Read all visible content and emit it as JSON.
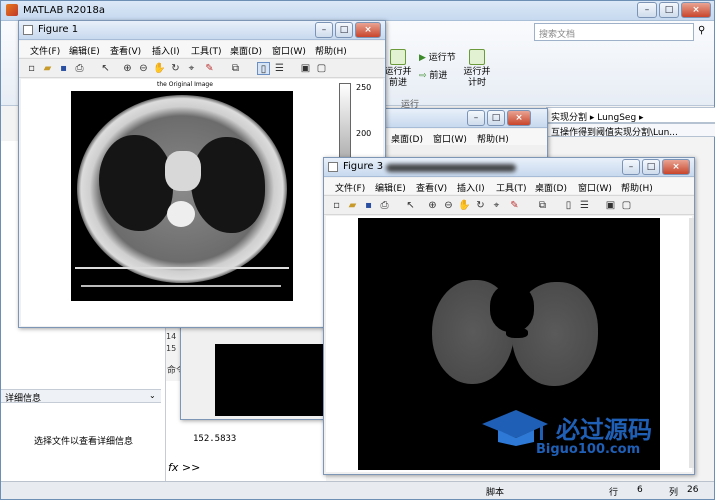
{
  "app": {
    "title": "MATLAB R2018a",
    "search_placeholder": "搜索文档"
  },
  "ribbon": {
    "run_advance_label": "运行并\n前进",
    "run_section_label": "运行节",
    "advance_label": "前进",
    "run_time_label": "运行并\n计时",
    "run_group_label": "运行"
  },
  "path": {
    "address": "实现分割 ▸ LungSeg ▸",
    "tab_text": "互操作得到阈值实现分割\\Lun..."
  },
  "left_panel": {
    "details_header": "详细信息",
    "details_text": "选择文件以查看详细信息"
  },
  "command_window": {
    "label": "命令",
    "value": "152.5833",
    "prompt": "fx >>",
    "line_numbers": [
      "14",
      "15"
    ]
  },
  "statusbar": {
    "script_label": "脚本",
    "row_label": "行",
    "row_value": "6",
    "col_label": "列",
    "col_value": "26"
  },
  "figure1": {
    "title": "Figure 1",
    "menu": [
      "文件(F)",
      "编辑(E)",
      "查看(V)",
      "插入(I)",
      "工具(T)",
      "桌面(D)",
      "窗口(W)",
      "帮助(H)"
    ],
    "image_title": "the Original Image",
    "colorbar_ticks": [
      "250",
      "200"
    ]
  },
  "figure_mid": {
    "menu": [
      "桌面(D)",
      "窗口(W)",
      "帮助(H)"
    ]
  },
  "figure3": {
    "title": "Figure 3",
    "menu": [
      "文件(F)",
      "编辑(E)",
      "查看(V)",
      "插入(I)",
      "工具(T)",
      "桌面(D)",
      "窗口(W)",
      "帮助(H)"
    ]
  },
  "watermark": {
    "brand_cn": "必过源码",
    "brand_url": "Biguo100.com"
  },
  "colors": {
    "accent_blue": "#1f5fb5",
    "title_bar": "#c8d9ee"
  }
}
